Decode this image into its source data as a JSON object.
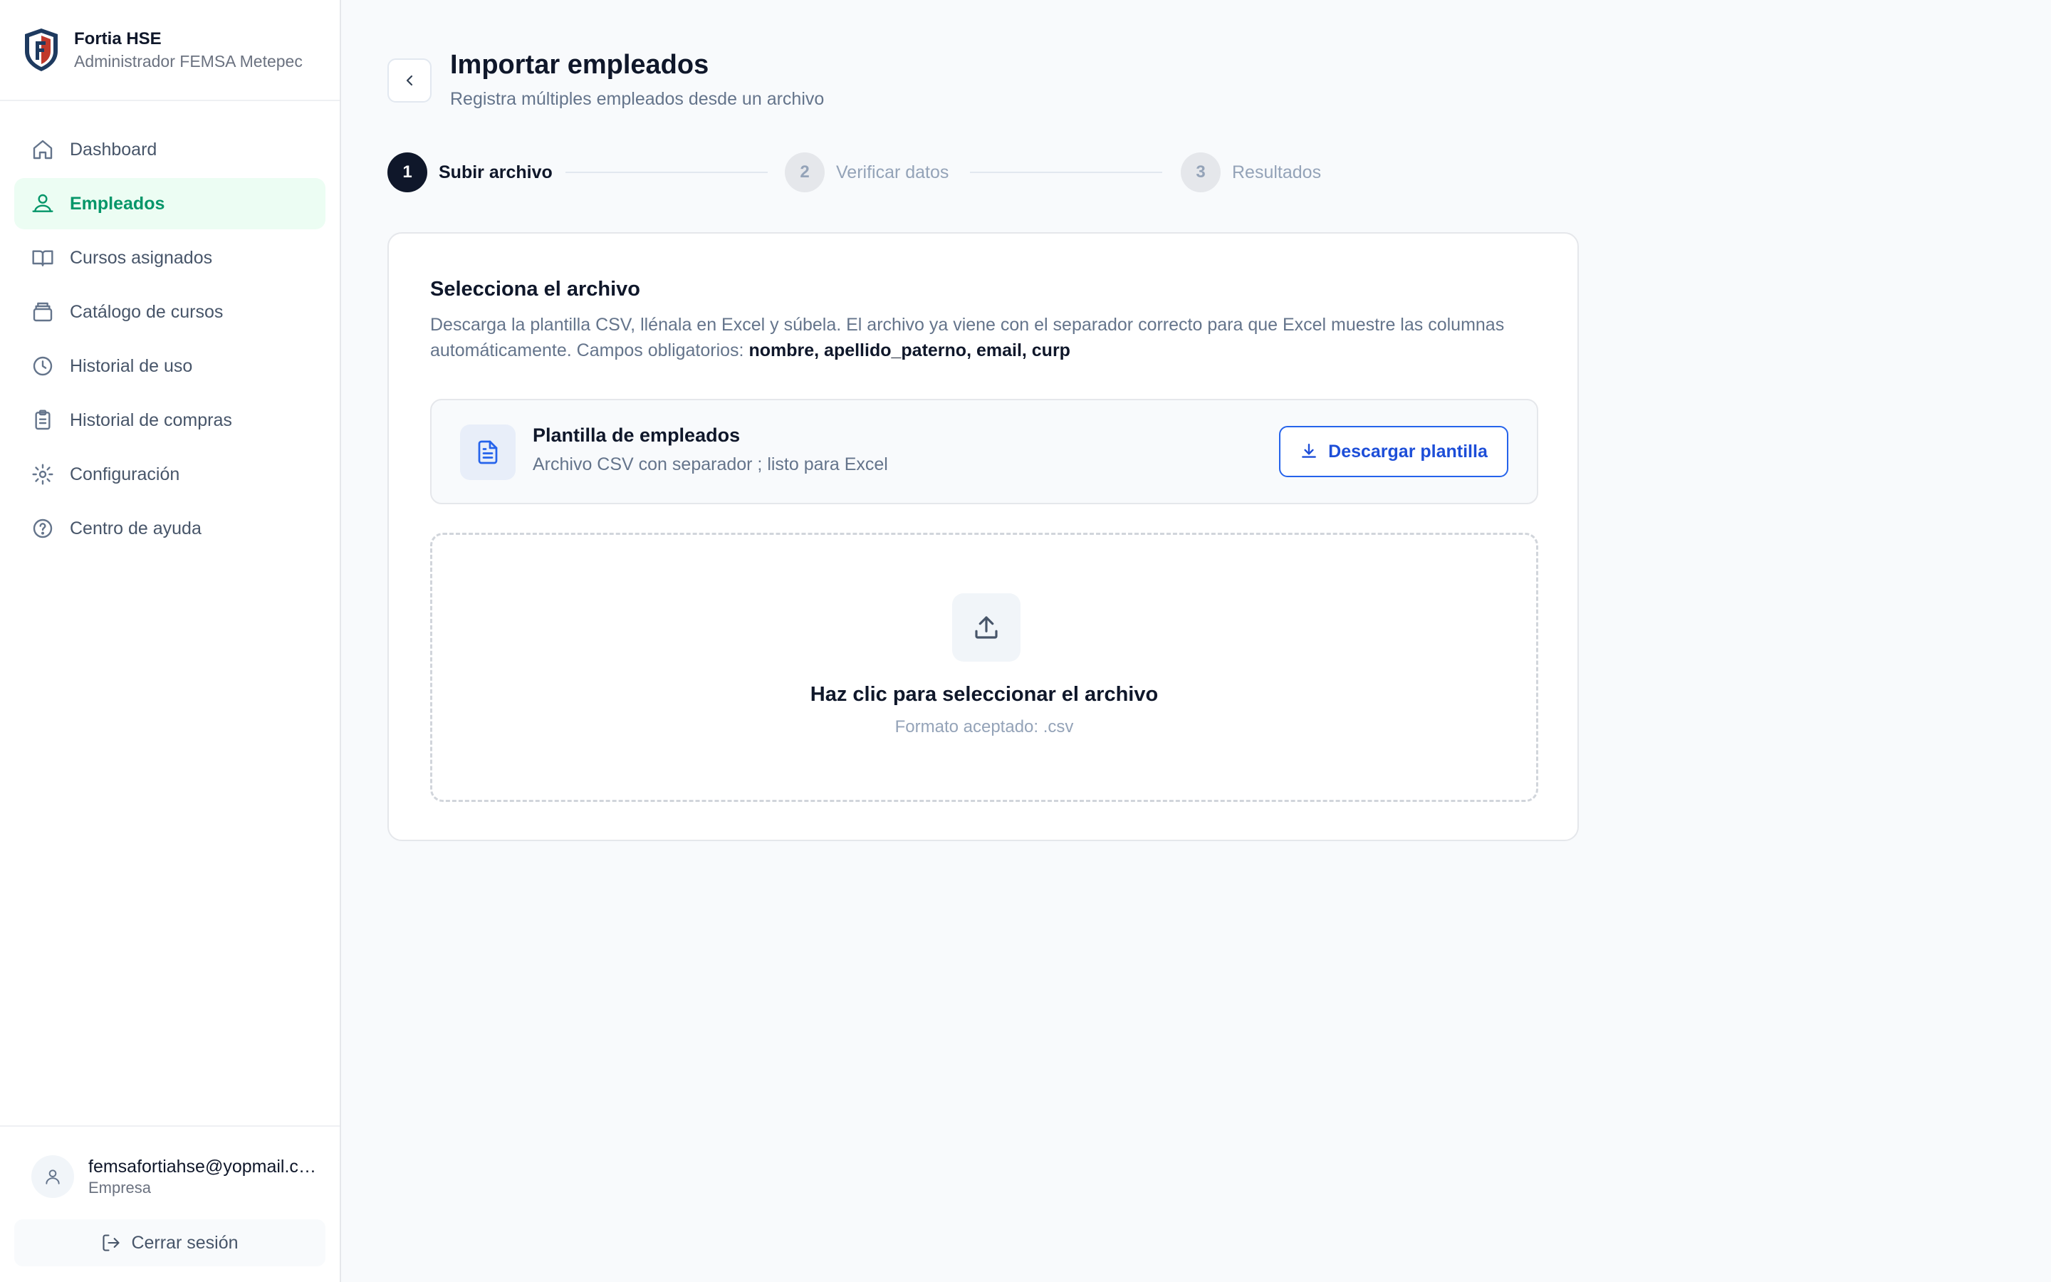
{
  "brand": {
    "name": "Fortia HSE",
    "subtitle": "Administrador FEMSA Metepec"
  },
  "sidebar": {
    "items": [
      {
        "label": "Dashboard",
        "icon": "home-icon",
        "active": false
      },
      {
        "label": "Empleados",
        "icon": "users-icon",
        "active": true
      },
      {
        "label": "Cursos asignados",
        "icon": "book-icon",
        "active": false
      },
      {
        "label": "Catálogo de cursos",
        "icon": "catalog-icon",
        "active": false
      },
      {
        "label": "Historial de uso",
        "icon": "clock-icon",
        "active": false
      },
      {
        "label": "Historial de compras",
        "icon": "clipboard-icon",
        "active": false
      },
      {
        "label": "Configuración",
        "icon": "gear-icon",
        "active": false
      },
      {
        "label": "Centro de ayuda",
        "icon": "help-icon",
        "active": false
      }
    ]
  },
  "user": {
    "email": "femsafortiahse@yopmail.com",
    "role": "Empresa",
    "logout_label": "Cerrar sesión"
  },
  "page": {
    "title": "Importar empleados",
    "subtitle": "Registra múltiples empleados desde un archivo"
  },
  "stepper": {
    "current": 1,
    "steps": [
      {
        "number": "1",
        "label": "Subir archivo"
      },
      {
        "number": "2",
        "label": "Verificar datos"
      },
      {
        "number": "3",
        "label": "Resultados"
      }
    ]
  },
  "card": {
    "title": "Selecciona el archivo",
    "description": "Descarga la plantilla CSV, llénala en Excel y súbela. El archivo ya viene con el separador correcto para que Excel muestre las columnas automáticamente. Campos obligatorios:",
    "required_fields": "nombre, apellido_paterno, email, curp",
    "template": {
      "title": "Plantilla de empleados",
      "subtitle": "Archivo CSV con separador ; listo para Excel",
      "download_label": "Descargar plantilla"
    },
    "dropzone": {
      "title": "Haz clic para seleccionar el archivo",
      "hint": "Formato aceptado: .csv"
    }
  },
  "colors": {
    "accent_green": "#059669",
    "active_bg": "#ecfdf3",
    "primary_blue": "#2563eb",
    "step_done": "#0f172a"
  }
}
